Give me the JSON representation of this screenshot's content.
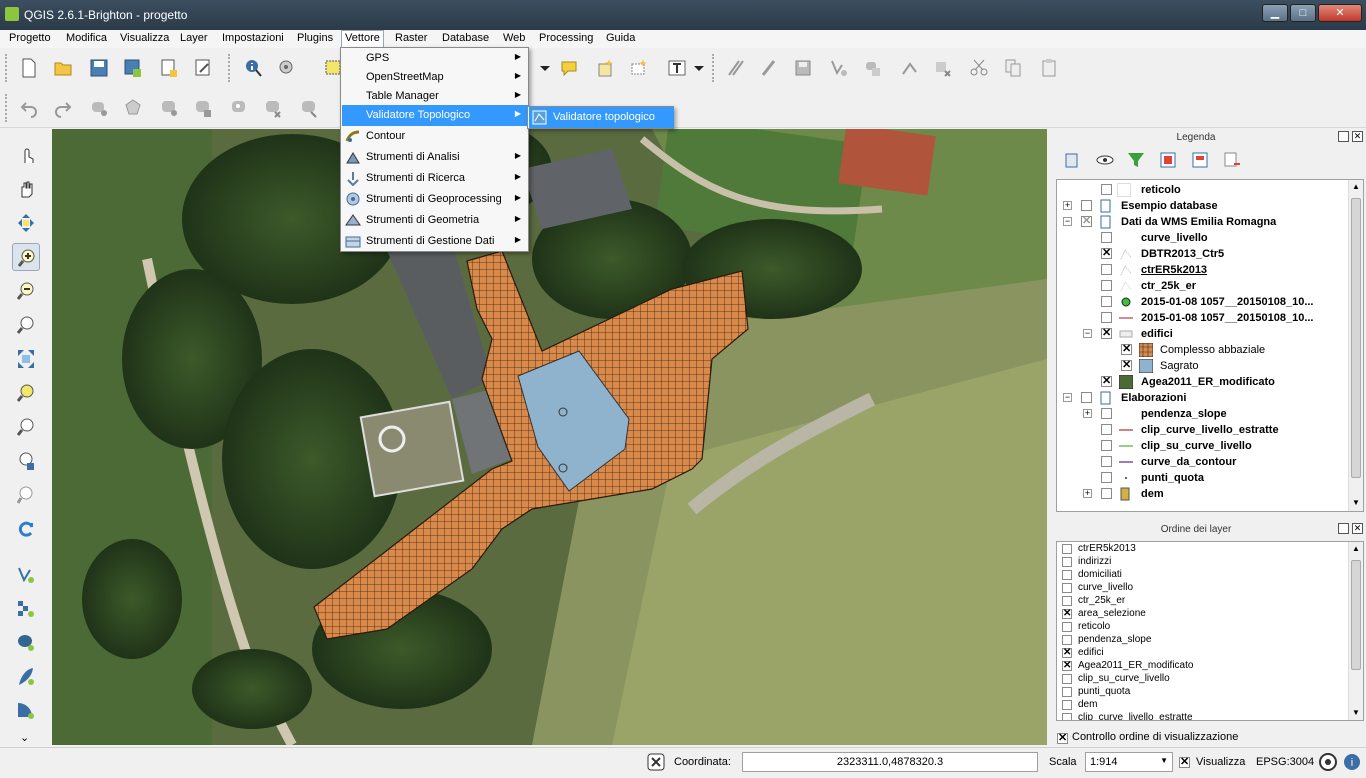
{
  "window": {
    "title": "QGIS 2.6.1-Brighton - progetto",
    "min_glyph": "▁",
    "max_glyph": "□",
    "close_glyph": "✕"
  },
  "menubar": {
    "items": [
      {
        "label": "Progetto"
      },
      {
        "label": "Modifica"
      },
      {
        "label": "Visualizza"
      },
      {
        "label": "Layer"
      },
      {
        "label": "Impostazioni"
      },
      {
        "label": "Plugins"
      },
      {
        "label": "Vettore"
      },
      {
        "label": "Raster"
      },
      {
        "label": "Database"
      },
      {
        "label": "Web"
      },
      {
        "label": "Processing"
      },
      {
        "label": "Guida"
      }
    ],
    "open": "Vettore"
  },
  "vector_menu": {
    "items": [
      {
        "label": "GPS",
        "icon": "none",
        "submenu": true
      },
      {
        "label": "OpenStreetMap",
        "icon": "none",
        "submenu": true
      },
      {
        "label": "Table Manager",
        "icon": "none",
        "submenu": true
      },
      {
        "label": "Validatore Topologico",
        "icon": "none",
        "submenu": true,
        "highlighted": true
      },
      {
        "label": "Contour",
        "icon": "contour-icon",
        "submenu": false
      },
      {
        "label": "Strumenti di Analisi",
        "icon": "analysis-icon",
        "submenu": true
      },
      {
        "label": "Strumenti di Ricerca",
        "icon": "research-icon",
        "submenu": true
      },
      {
        "label": "Strumenti di Geoprocessing",
        "icon": "geoprocessing-icon",
        "submenu": true
      },
      {
        "label": "Strumenti di Geometria",
        "icon": "geometry-icon",
        "submenu": true
      },
      {
        "label": "Strumenti di Gestione Dati",
        "icon": "data-management-icon",
        "submenu": true
      }
    ]
  },
  "topology_submenu": {
    "items": [
      {
        "label": "Validatore topologico",
        "icon": "topology-checker-icon"
      }
    ]
  },
  "legend": {
    "title": "Legenda",
    "rows": [
      {
        "label": "reticolo",
        "checked": false,
        "bold": true
      },
      {
        "label": "Esempio database",
        "checked": false,
        "bold": true,
        "group": true
      },
      {
        "label": "Dati da WMS Emilia Romagna",
        "checked": "partial",
        "bold": true,
        "group": true
      },
      {
        "label": "curve_livello",
        "checked": false,
        "bold": true
      },
      {
        "label": "DBTR2013_Ctr5",
        "checked": true,
        "bold": true
      },
      {
        "label": "ctrER5k2013",
        "checked": false,
        "bold": true
      },
      {
        "label": "ctr_25k_er",
        "checked": false,
        "bold": true
      },
      {
        "label": "2015-01-08 1057__20150108_10...",
        "checked": false,
        "bold": true
      },
      {
        "label": "2015-01-08 1057__20150108_10...",
        "checked": false,
        "bold": true
      },
      {
        "label": "edifici",
        "checked": true,
        "bold": true
      },
      {
        "label": "Complesso abbaziale",
        "checked": true,
        "bold": false
      },
      {
        "label": "Sagrato",
        "checked": true,
        "bold": false
      },
      {
        "label": "Agea2011_ER_modificato",
        "checked": true,
        "bold": true
      },
      {
        "label": "Elaborazioni",
        "checked": false,
        "bold": true,
        "group": true
      },
      {
        "label": "pendenza_slope",
        "checked": false,
        "bold": true
      },
      {
        "label": "clip_curve_livello_estratte",
        "checked": false,
        "bold": true
      },
      {
        "label": "clip_su_curve_livello",
        "checked": false,
        "bold": true
      },
      {
        "label": "curve_da_contour",
        "checked": false,
        "bold": true
      },
      {
        "label": "punti_quota",
        "checked": false,
        "bold": true
      },
      {
        "label": "dem",
        "checked": false,
        "bold": true
      }
    ]
  },
  "layer_order": {
    "title": "Ordine dei layer",
    "rows": [
      {
        "label": "ctrER5k2013",
        "checked": false
      },
      {
        "label": "indirizzi",
        "checked": false
      },
      {
        "label": "domiciliati",
        "checked": false
      },
      {
        "label": "curve_livello",
        "checked": false
      },
      {
        "label": "ctr_25k_er",
        "checked": false
      },
      {
        "label": "area_selezione",
        "checked": true
      },
      {
        "label": "reticolo",
        "checked": false
      },
      {
        "label": "pendenza_slope",
        "checked": false
      },
      {
        "label": "edifici",
        "checked": true
      },
      {
        "label": "Agea2011_ER_modificato",
        "checked": true
      },
      {
        "label": "clip_su_curve_livello",
        "checked": false
      },
      {
        "label": "punti_quota",
        "checked": false
      },
      {
        "label": "dem",
        "checked": false
      },
      {
        "label": "clip_curve_livello_estratte",
        "checked": false
      }
    ],
    "control_label": "Controllo ordine di visualizzazione",
    "control_checked": true
  },
  "statusbar": {
    "coord_label": "Coordinata:",
    "coord_value": "2323311.0,4878320.3",
    "scale_label": "Scala",
    "scale_value": "1:914",
    "render_label": "Visualizza",
    "render_checked": true,
    "crs": "EPSG:3004"
  },
  "colors": {
    "accent": "#3399ff",
    "building_fill": "#d98a4a",
    "sagrato_fill": "#8fb3cc",
    "titlebar": "#2f4050"
  }
}
